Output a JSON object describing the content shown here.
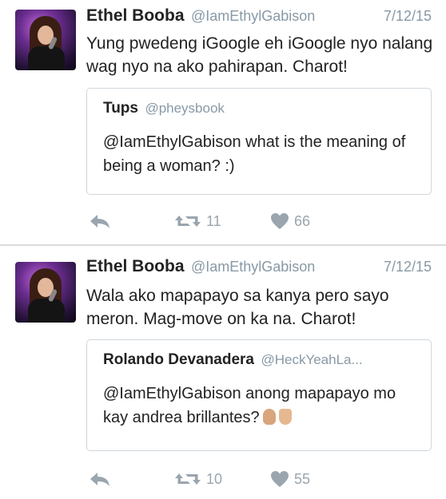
{
  "tweets": [
    {
      "author": {
        "name": "Ethel Booba",
        "handle": "@IamEthylGabison"
      },
      "date": "7/12/15",
      "text": "Yung pwedeng iGoogle eh iGoogle nyo nalang wag nyo na ako pahirapan. Charot!",
      "quote": {
        "name": "Tups",
        "handle": "@pheysbook",
        "text": "@IamEthylGabison what is the meaning of being a woman? :)"
      },
      "retweets": "11",
      "likes": "66"
    },
    {
      "author": {
        "name": "Ethel Booba",
        "handle": "@IamEthylGabison"
      },
      "date": "7/12/15",
      "text": "Wala ako mapapayo sa kanya pero sayo meron. Mag-move on ka na. Charot!",
      "quote": {
        "name": "Rolando Devanadera",
        "handle": "@HeckYeahLa...",
        "text": "@IamEthylGabison anong mapapayo mo kay andrea brillantes?"
      },
      "retweets": "10",
      "likes": "55"
    }
  ],
  "icons": {
    "reply": "reply-icon",
    "retweet": "retweet-icon",
    "like": "heart-icon",
    "emoji_1": "ok-hand-emoji",
    "emoji_2": "victory-hand-emoji"
  },
  "colors": {
    "muted": "#8899a6",
    "icon": "#9aa5ae",
    "border": "#cfd6dc"
  }
}
